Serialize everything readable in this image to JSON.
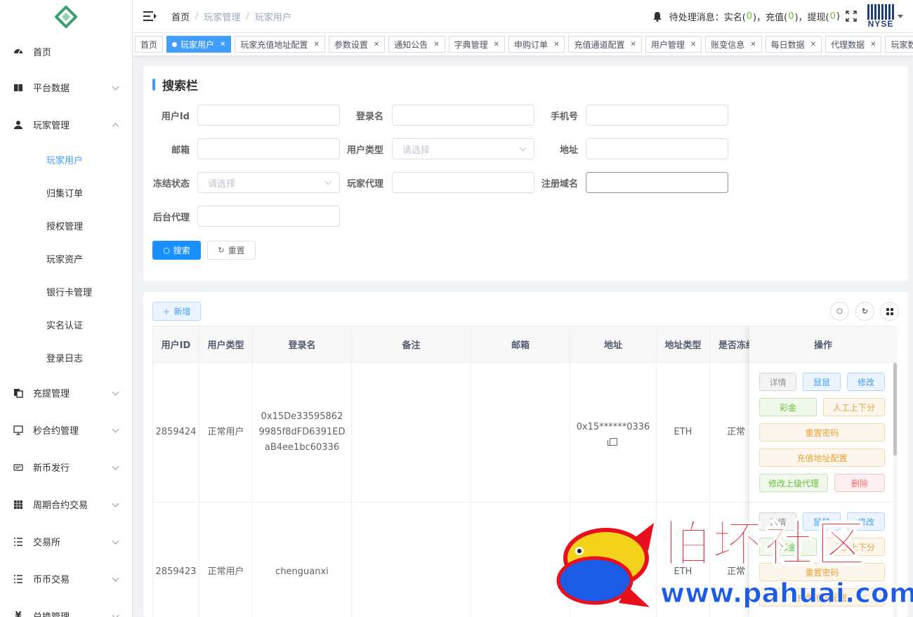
{
  "sidebar": {
    "items": [
      {
        "label": "首页",
        "icon": "dashboard-icon"
      },
      {
        "label": "平台数据",
        "icon": "book-icon"
      },
      {
        "label": "玩家管理",
        "icon": "user-icon"
      },
      {
        "label": "充提管理",
        "icon": "documents-icon"
      },
      {
        "label": "秒合约管理",
        "icon": "monitor-icon"
      },
      {
        "label": "新币发行",
        "icon": "coin-icon"
      },
      {
        "label": "周期合约交易",
        "icon": "grid-icon"
      },
      {
        "label": "交易所",
        "icon": "list-icon"
      },
      {
        "label": "币币交易",
        "icon": "list-icon"
      },
      {
        "label": "兑换管理",
        "icon": "yen-icon"
      }
    ],
    "sub_items": [
      "玩家用户",
      "归集订单",
      "授权管理",
      "玩家资产",
      "银行卡管理",
      "实名认证",
      "登录日志"
    ]
  },
  "header": {
    "breadcrumb": [
      "首页",
      "玩家管理",
      "玩家用户"
    ],
    "message_prefix": "待处理消息：实名(",
    "realname_count": "0",
    "recharge_label": ")，充值(",
    "recharge_count": "0",
    "withdraw_label": ")，提现(",
    "withdraw_count": "0",
    "message_suffix": ")",
    "avatar_text": "NYSE"
  },
  "tags": [
    {
      "label": "首页",
      "closable": false,
      "active": false
    },
    {
      "label": "玩家用户",
      "closable": true,
      "active": true
    },
    {
      "label": "玩家充值地址配置",
      "closable": true,
      "active": false
    },
    {
      "label": "参数设置",
      "closable": true,
      "active": false
    },
    {
      "label": "通知公告",
      "closable": true,
      "active": false
    },
    {
      "label": "字典管理",
      "closable": true,
      "active": false
    },
    {
      "label": "申购订单",
      "closable": true,
      "active": false
    },
    {
      "label": "充值通道配置",
      "closable": true,
      "active": false
    },
    {
      "label": "用户管理",
      "closable": true,
      "active": false
    },
    {
      "label": "账变信息",
      "closable": true,
      "active": false
    },
    {
      "label": "每日数据",
      "closable": true,
      "active": false
    },
    {
      "label": "代理数据",
      "closable": true,
      "active": false
    },
    {
      "label": "玩家数据",
      "closable": false,
      "active": false
    }
  ],
  "search": {
    "title": "搜索栏",
    "fields": {
      "user_id": {
        "label": "用户Id",
        "placeholder": ""
      },
      "login_name": {
        "label": "登录名",
        "placeholder": ""
      },
      "phone": {
        "label": "手机号",
        "placeholder": ""
      },
      "email": {
        "label": "邮箱",
        "placeholder": ""
      },
      "user_type": {
        "label": "用户类型",
        "placeholder": "请选择"
      },
      "address": {
        "label": "地址",
        "placeholder": ""
      },
      "freeze_status": {
        "label": "冻结状态",
        "placeholder": "请选择"
      },
      "player_agent": {
        "label": "玩家代理",
        "placeholder": ""
      },
      "register_domain": {
        "label": "注册域名",
        "placeholder": ""
      },
      "backend_agent": {
        "label": "后台代理",
        "placeholder": ""
      }
    },
    "search_button": "搜索",
    "reset_button": "重置"
  },
  "table": {
    "add_button": "新增",
    "columns": [
      "用户ID",
      "用户类型",
      "登录名",
      "备注",
      "邮箱",
      "地址",
      "地址类型",
      "是否冻结"
    ],
    "ops_header": "操作",
    "rows": [
      {
        "id": "2859424",
        "user_type": "正常用户",
        "login_name": "0x15De335958629985f8dFD6391EDaB4ee1bc60336",
        "remark": "",
        "email": "",
        "address": "0x15******0336",
        "address_type": "ETH",
        "frozen": "正常"
      },
      {
        "id": "2859423",
        "user_type": "正常用户",
        "login_name": "chenguanxi",
        "remark": "",
        "email": "",
        "address": "",
        "address_type": "ETH",
        "frozen": "正常"
      }
    ],
    "ops": {
      "detail": "详情",
      "mouse": "鼠鼠",
      "edit": "修改",
      "bonus": "彩金",
      "manual": "人工上下分",
      "reset_pwd": "重置密码",
      "recharge_addr": "充值地址配置",
      "edit_agent": "修改上级代理",
      "delete": "删除"
    }
  },
  "watermark": {
    "title": "怕坏社区",
    "url": "www.pahuai.com"
  }
}
